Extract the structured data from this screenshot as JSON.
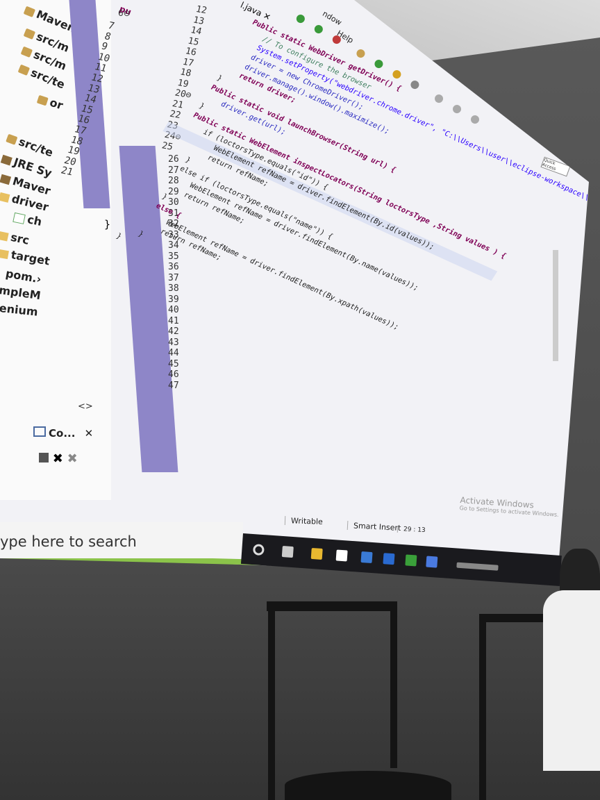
{
  "menu": {
    "window": "ndow",
    "help": "Help"
  },
  "editor_tab": "l.java",
  "quick_access": "Quick Access",
  "tree": {
    "items": [
      {
        "label": "MavenPr",
        "icon": "project-icon"
      },
      {
        "label": "src/m",
        "icon": "package-folder-icon"
      },
      {
        "label": "src/m",
        "icon": "package-folder-icon"
      },
      {
        "label": "src/te",
        "icon": "package-folder-icon"
      },
      {
        "label": "or",
        "icon": "package-icon"
      },
      {
        "label": "src/te",
        "icon": "package-folder-icon"
      },
      {
        "label": "JRE Sy",
        "icon": "library-icon"
      },
      {
        "label": "Maver",
        "icon": "library-icon"
      },
      {
        "label": "driver",
        "icon": "folder-icon"
      },
      {
        "label": "ch",
        "icon": "file-icon"
      },
      {
        "label": "src",
        "icon": "folder-icon"
      },
      {
        "label": "target",
        "icon": "folder-icon"
      },
      {
        "label": "pom.›",
        "icon": "xml-icon"
      },
      {
        "label": "mpleM",
        "icon": "project-icon"
      },
      {
        "label": "enium",
        "icon": "project-icon"
      }
    ]
  },
  "left_gutter": {
    "line_numbers": [
      "7",
      "8",
      "9",
      "10",
      "11",
      "12",
      "13",
      "14",
      "15",
      "16",
      "17",
      "18",
      "19",
      "20",
      "21"
    ],
    "closing_brace": "}",
    "top_label": "6⊖"
  },
  "outline_partial": "pu",
  "gutter_numbers": [
    "12",
    "13",
    "14",
    "15",
    "16",
    "17",
    "18",
    "19",
    "20⊖",
    "21",
    "22",
    "23",
    "24⊖",
    "25",
    "26",
    "27",
    "28",
    "29",
    "30",
    "31",
    "32",
    "33",
    "34",
    "35",
    "36",
    "37",
    "38",
    "39",
    "40",
    "41",
    "42",
    "43",
    "44",
    "45",
    "46",
    "47"
  ],
  "code_lines": [
    "    Public static WebDriver getDriver() {",
    "        // To configure the browser",
    "        System.setProperty(\"webdriver.chrome.driver\", \"C:\\\\Users\\\\user\\\\eclipse-workspace\\\\MavenProject\\\\driver\\\\chromedriver.exe\");",
    "        driver = new ChromeDriver();",
    "        driver.manage().window().maximize();",
    "        return driver;",
    "    }",
    "    Public static void launchBrowser(String url) {",
    "        driver.get(url);",
    "    }",
    "    Public static WebElement inspectLocators(String loctorsType ,String values ) {",
    "        if (loctorsType.equals(\"id\")) {",
    "            WebElement refName = driver.findElement(By.id(values));",
    "            return refName;",
    "        }",
    "        else if (loctorsType.equals(\"name\")) {",
    "            WebElement refName = driver.findElement(By.name(values));",
    "            return refName;",
    "        }",
    "        else {",
    "            WebElement refName = driver.findElement(By.xpath(values));",
    "            return refName;",
    "        }",
    "    }"
  ],
  "console_tab": "Co...",
  "status": {
    "mode": "Writable",
    "insert": "Smart Insert",
    "position": "29 : 13"
  },
  "watermark": {
    "line1": "Activate Windows",
    "line2": "Go to Settings to activate Windows."
  },
  "taskbar": {
    "search_placeholder": "ype here to search"
  }
}
